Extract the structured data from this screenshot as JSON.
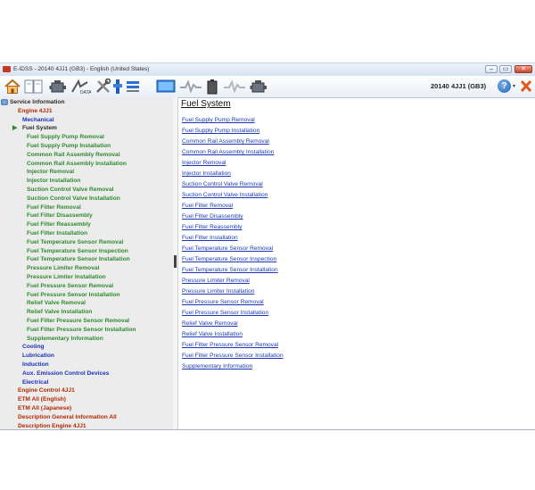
{
  "window": {
    "title": "E-IDSS - 20140 4JJ1 (GB3) - English (United States)",
    "controls": {
      "minimize": "–",
      "maximize": "▭",
      "close": "✕"
    }
  },
  "toolbar": {
    "vehicle": "20140 4JJ1 (GB3)",
    "help_glyph": "?",
    "help_dropdown": "▾",
    "icons": [
      "home-icon",
      "book-icon",
      "engine-icon",
      "engine-data-icon",
      "tools-icon",
      "connector-icon",
      "list-icon",
      "monitor-icon",
      "waveform-icon",
      "battery-icon",
      "signal-icon",
      "engine-alt-icon",
      "help-icon",
      "exit-icon"
    ]
  },
  "tree": {
    "items": [
      {
        "label": "Service Information",
        "level": 0,
        "color": "dark"
      },
      {
        "label": "Engine 4JJ1",
        "level": 1,
        "color": "red"
      },
      {
        "label": "Mechanical",
        "level": 2,
        "color": "blue"
      },
      {
        "label": "Fuel System",
        "level": 2,
        "color": "dark",
        "selected": true
      },
      {
        "label": "Fuel Supply Pump Removal",
        "level": 3,
        "color": "green"
      },
      {
        "label": "Fuel Supply Pump Installation",
        "level": 3,
        "color": "green"
      },
      {
        "label": "Common Rail Assembly Removal",
        "level": 3,
        "color": "green"
      },
      {
        "label": "Common Rail Assembly Installation",
        "level": 3,
        "color": "green"
      },
      {
        "label": "Injector Removal",
        "level": 3,
        "color": "green"
      },
      {
        "label": "Injector Installation",
        "level": 3,
        "color": "green"
      },
      {
        "label": "Suction Control Valve Removal",
        "level": 3,
        "color": "green"
      },
      {
        "label": "Suction Control Valve Installation",
        "level": 3,
        "color": "green"
      },
      {
        "label": "Fuel Filter Removal",
        "level": 3,
        "color": "green"
      },
      {
        "label": "Fuel Filter Disassembly",
        "level": 3,
        "color": "green"
      },
      {
        "label": "Fuel Filter Reassembly",
        "level": 3,
        "color": "green"
      },
      {
        "label": "Fuel Filter Installation",
        "level": 3,
        "color": "green"
      },
      {
        "label": "Fuel Temperature Sensor Removal",
        "level": 3,
        "color": "green"
      },
      {
        "label": "Fuel Temperature Sensor Inspection",
        "level": 3,
        "color": "green"
      },
      {
        "label": "Fuel Temperature Sensor Installation",
        "level": 3,
        "color": "green"
      },
      {
        "label": "Pressure Limiter Removal",
        "level": 3,
        "color": "green"
      },
      {
        "label": "Pressure Limiter Installation",
        "level": 3,
        "color": "green"
      },
      {
        "label": "Fuel Pressure Sensor Removal",
        "level": 3,
        "color": "green"
      },
      {
        "label": "Fuel Pressure Sensor Installation",
        "level": 3,
        "color": "green"
      },
      {
        "label": "Relief Valve Removal",
        "level": 3,
        "color": "green"
      },
      {
        "label": "Relief Valve Installation",
        "level": 3,
        "color": "green"
      },
      {
        "label": "Fuel Filter Pressure Sensor Removal",
        "level": 3,
        "color": "green"
      },
      {
        "label": "Fuel Filter Pressure Sensor Installation",
        "level": 3,
        "color": "green"
      },
      {
        "label": "Supplementary Information",
        "level": 3,
        "color": "green"
      },
      {
        "label": "Cooling",
        "level": 2,
        "color": "blue"
      },
      {
        "label": "Lubrication",
        "level": 2,
        "color": "blue"
      },
      {
        "label": "Induction",
        "level": 2,
        "color": "blue"
      },
      {
        "label": "Aux. Emission Control Devices",
        "level": 2,
        "color": "blue"
      },
      {
        "label": "Electrical",
        "level": 2,
        "color": "blue"
      },
      {
        "label": "Engine Control 4JJ1",
        "level": 1,
        "color": "red"
      },
      {
        "label": "ETM All (English)",
        "level": 1,
        "color": "red"
      },
      {
        "label": "ETM All (Japanese)",
        "level": 1,
        "color": "red"
      },
      {
        "label": "Description General Information All",
        "level": 1,
        "color": "red"
      },
      {
        "label": "Description Engine 4JJ1",
        "level": 1,
        "color": "red"
      }
    ]
  },
  "content": {
    "title": "Fuel System",
    "links": [
      "Fuel Supply Pump Removal",
      "Fuel Supply Pump Installation",
      "Common Rail Assembly Removal",
      "Common Rail Assembly Installation",
      "Injector Removal",
      "Injector Installation",
      "Suction Control Valve Removal",
      "Suction Control Valve Installation",
      "Fuel Filter Removal",
      "Fuel Filter Disassembly",
      "Fuel Filter Reassembly",
      "Fuel Filter Installation",
      "Fuel Temperature Sensor Removal",
      "Fuel Temperature Sensor Inspection",
      "Fuel Temperature Sensor Installation",
      "Pressure Limiter Removal",
      "Pressure Limiter Installation",
      "Fuel Pressure Sensor Removal",
      "Fuel Pressure Sensor Installation",
      "Relief Valve Removal",
      "Relief Valve Installation",
      "Fuel Filter Pressure Sensor Removal",
      "Fuel Filter Pressure Sensor Installation",
      "Supplementary Information"
    ]
  },
  "colors": {
    "tree_dark": "#2a2a2a",
    "tree_red": "#b22a00",
    "tree_blue": "#1a32b8",
    "tree_green": "#2f8a2f",
    "link": "#1a3bb3"
  }
}
